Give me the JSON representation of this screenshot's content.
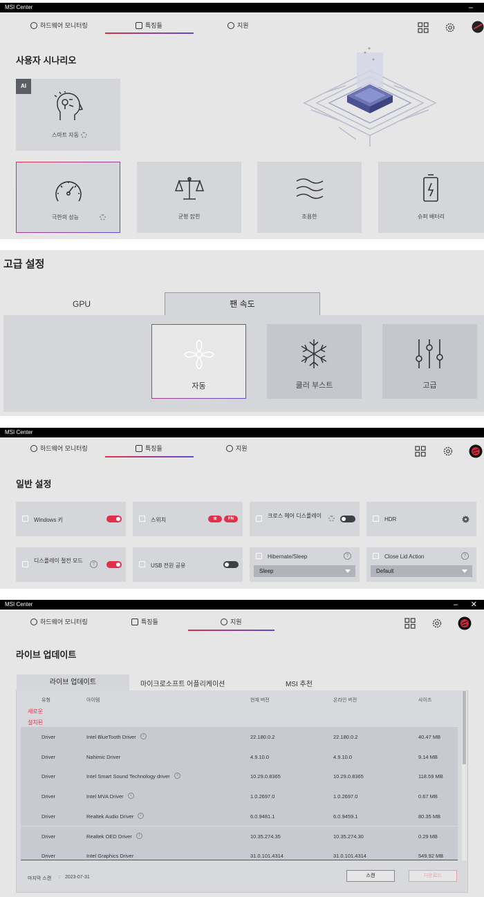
{
  "app": {
    "title": "MSI Center"
  },
  "tabs": {
    "hardware": "하드웨어 모니터링",
    "features": "특징들",
    "support": "지원"
  },
  "scenario": {
    "title": "사용자 시나리오",
    "ai_badge": "AI",
    "smart_auto": "스마트 자동",
    "cards": [
      "극한의 성능",
      "균형 잡힌",
      "조용한",
      "슈퍼 배터리"
    ]
  },
  "advanced": {
    "title": "고급 설정",
    "tabs": [
      "GPU",
      "팬 속도"
    ],
    "cards": [
      "자동",
      "쿨러 부스트",
      "고급"
    ]
  },
  "general": {
    "title": "일반 설정",
    "windows_key": "Windows 키",
    "switch": "스위치",
    "switch_pills": [
      "⊞",
      "FN"
    ],
    "crosshair": "크로스 헤어 디스플레이",
    "hdr": "HDR",
    "display_power": "디스플레이 절전 모드",
    "usb_power": "USB 전원 공유",
    "hibernate": {
      "label": "Hibernate/Sleep",
      "value": "Sleep"
    },
    "lid": {
      "label": "Close Lid Action",
      "value": "Default"
    },
    "help_mark": "?"
  },
  "live_update": {
    "title": "라이브 업데이트",
    "tabs": [
      "라이브 업데이트",
      "마이크로소프트 어플리케이션",
      "MSI 추천"
    ],
    "columns": [
      "유형",
      "아이템",
      "현재 버전",
      "온라인 버전",
      "사이즈"
    ],
    "group_new": "새로운",
    "group_installed": "설치된",
    "rows": [
      {
        "type": "Driver",
        "item": "Intel BlueTooth Driver",
        "info": true,
        "current": "22.180.0.2",
        "online": "22.180.0.2",
        "size": "40.47 MB"
      },
      {
        "type": "Driver",
        "item": "Nahimic Driver",
        "info": false,
        "current": "4.9.10.0",
        "online": "4.9.10.0",
        "size": "9.14 MB"
      },
      {
        "type": "Driver",
        "item": "Intel Smart Sound Technology driver",
        "info": true,
        "current": "10.29.0.8365",
        "online": "10.29.0.8365",
        "size": "118.59 MB"
      },
      {
        "type": "Driver",
        "item": "Intel MVA Driver",
        "info": true,
        "current": "1.0.2697.0",
        "online": "1.0.2697.0",
        "size": "0.67 MB"
      },
      {
        "type": "Driver",
        "item": "Realtek Audio Driver",
        "info": true,
        "current": "6.0.9481.1",
        "online": "6.0.9459.1",
        "size": "80.35 MB"
      },
      {
        "type": "Driver",
        "item": "Realtek OED Driver",
        "info": true,
        "current": "10.35.274.35",
        "online": "10.35.274.30",
        "size": "0.29 MB"
      },
      {
        "type": "Driver",
        "item": "Intel Graphics Driver",
        "info": false,
        "current": "31.0.101.4314",
        "online": "31.0.101.4314",
        "size": "549.92 MB"
      }
    ],
    "info_mark": "i",
    "last_scan_label": "마지막 스캔",
    "last_scan_sep": ":",
    "last_scan_date": "2023-07-31",
    "scan_button": "스캔",
    "download_button": "다운로드"
  },
  "colors": {
    "accent_red": "#e0304a",
    "accent_purple": "#5a4bd8"
  }
}
